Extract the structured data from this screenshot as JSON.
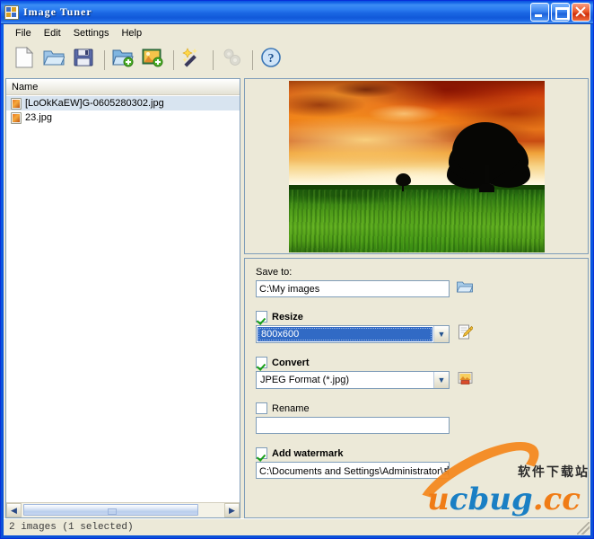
{
  "window": {
    "title": "Image Tuner",
    "icon": "app-icon",
    "controls": {
      "minimize": "minimize",
      "maximize": "maximize",
      "close": "close"
    }
  },
  "menu": {
    "items": [
      {
        "label": "File"
      },
      {
        "label": "Edit"
      },
      {
        "label": "Settings"
      },
      {
        "label": "Help"
      }
    ]
  },
  "toolbar": {
    "buttons": [
      {
        "name": "new-list",
        "icon": "page-icon",
        "enabled": true
      },
      {
        "name": "open-list",
        "icon": "open-folder-icon",
        "enabled": true
      },
      {
        "name": "save-list",
        "icon": "floppy-disk-icon",
        "enabled": true
      },
      {
        "name": "add-folder",
        "icon": "add-folder-icon",
        "enabled": true
      },
      {
        "name": "add-images",
        "icon": "add-image-icon",
        "enabled": true
      },
      {
        "name": "process",
        "icon": "magic-wand-icon",
        "enabled": true
      },
      {
        "name": "settings",
        "icon": "gears-icon",
        "enabled": false
      },
      {
        "name": "help",
        "icon": "question-help-icon",
        "enabled": true
      }
    ]
  },
  "file_list": {
    "column_header": "Name",
    "rows": [
      {
        "name": "[LoOkKaEW]G-0605280302.jpg",
        "selected": true
      },
      {
        "name": "23.jpg",
        "selected": false
      }
    ],
    "scrollbar": {
      "left_arrow": "◀",
      "right_arrow": "▶"
    }
  },
  "preview": {
    "alt": "sunset-landscape-with-tree-preview"
  },
  "settings": {
    "save_to": {
      "label": "Save to:",
      "value": "C:\\My images",
      "placeholder": "",
      "browse_icon": "folder-browse-icon"
    },
    "resize": {
      "label": "Resize",
      "checked": true,
      "value": "800x600",
      "edit_icon": "edit-pencil-icon",
      "arrow": "▼"
    },
    "convert": {
      "label": "Convert",
      "checked": true,
      "value": "JPEG Format (*.jpg)",
      "options_icon": "format-options-icon",
      "arrow": "▼"
    },
    "rename": {
      "label": "Rename",
      "checked": false,
      "value": "",
      "placeholder": ""
    },
    "watermark": {
      "label": "Add watermark",
      "checked": true,
      "value": "C:\\Documents and Settings\\Administrator\\桌面\\"
    }
  },
  "statusbar": {
    "text": "2 images (1 selected)"
  },
  "overlay_watermark": {
    "chinese": "软件下载站",
    "part1": "u",
    "part2": "c",
    "part3": "bug",
    "part4": ".cc"
  },
  "colors": {
    "titlebar_blue": "#0a5ce8",
    "selection_blue": "#316ac5",
    "face": "#ece9d8",
    "field_border": "#7f9db9",
    "check_green": "#18a018",
    "close_red": "#cf2f0c",
    "watermark_orange": "#f58a20",
    "watermark_blue": "#1a7fc4"
  }
}
